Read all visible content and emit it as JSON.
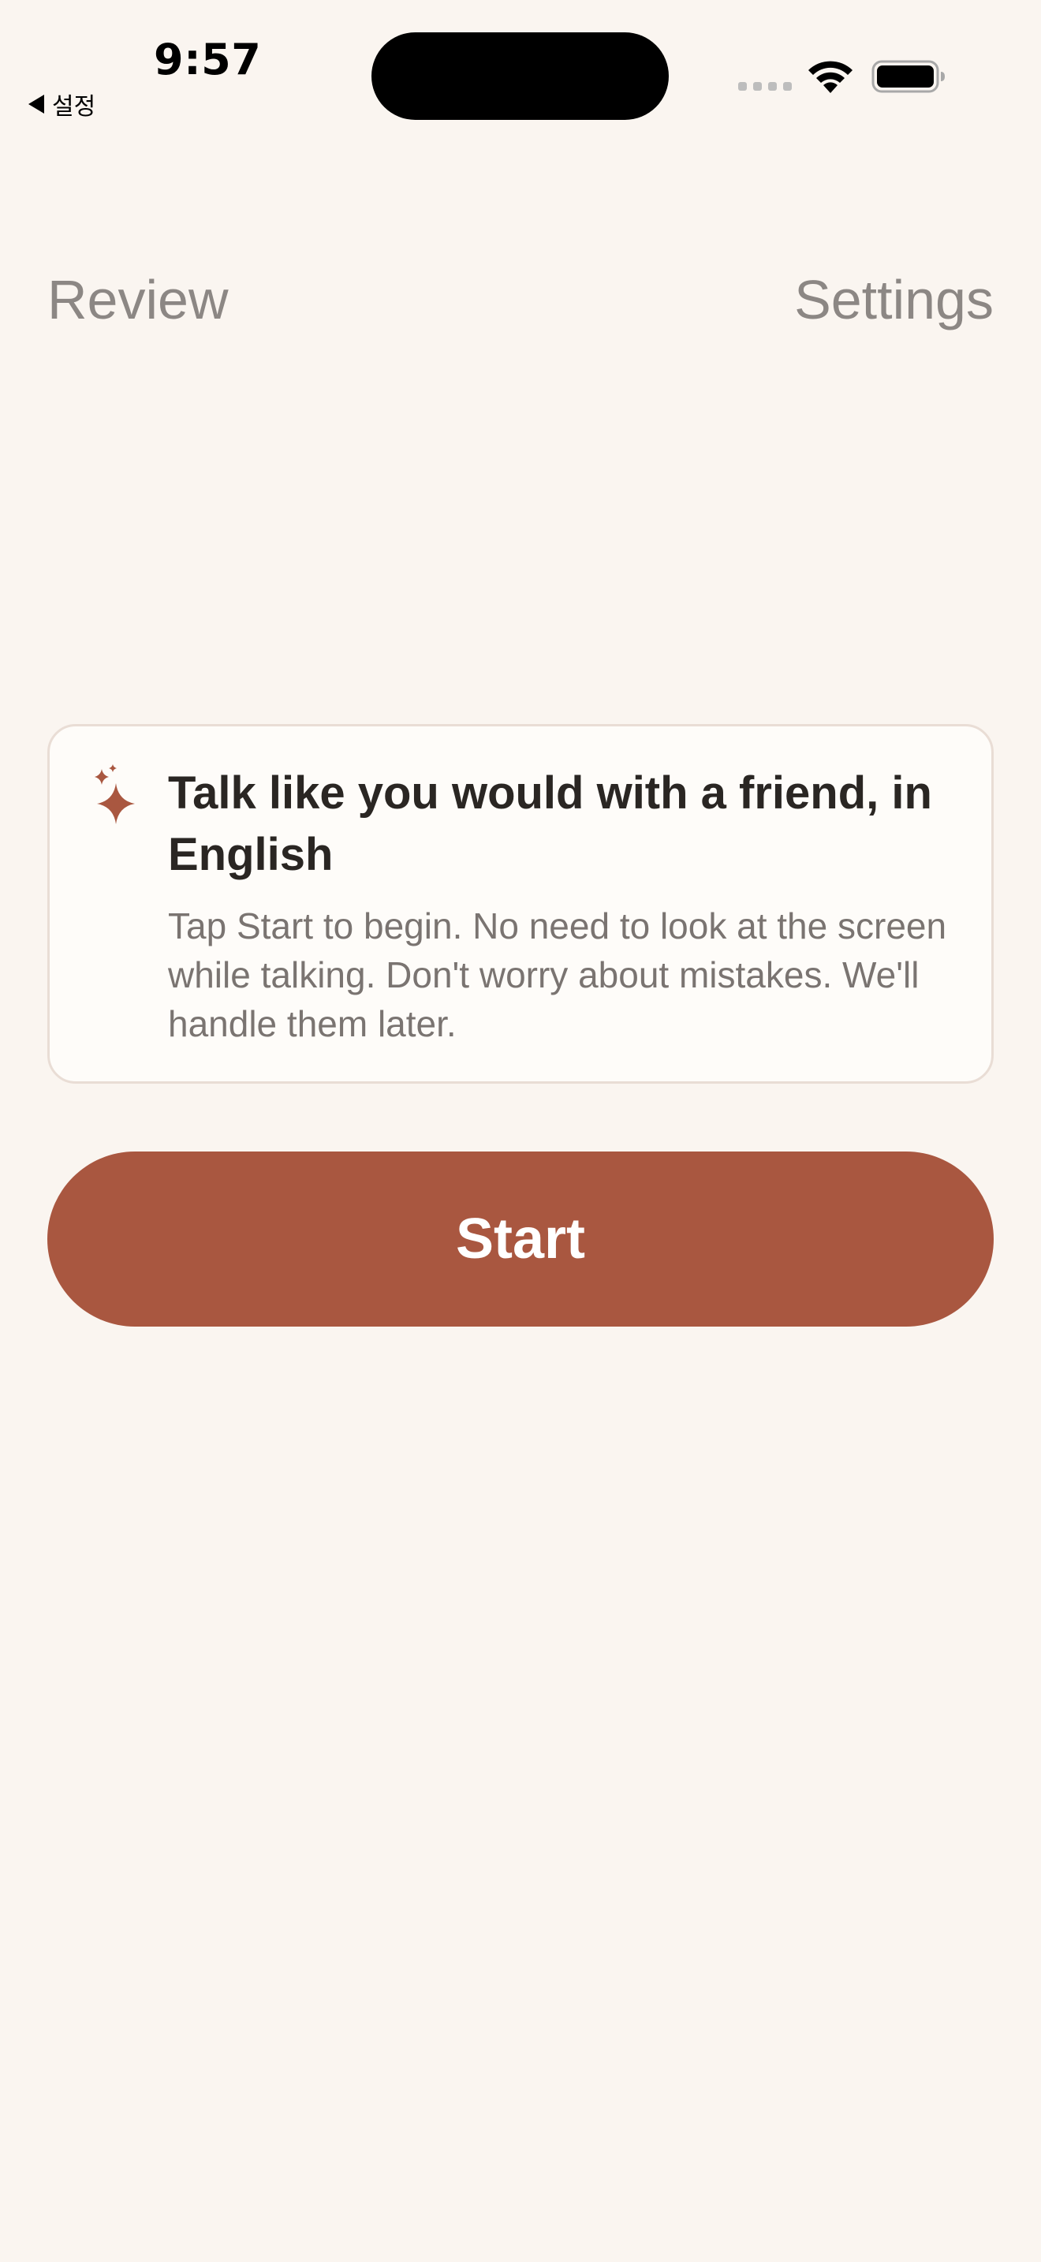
{
  "status_bar": {
    "time": "9:57",
    "back_label": "설정",
    "icons": [
      "signal-dots-icon",
      "wifi-icon",
      "battery-icon"
    ]
  },
  "nav": {
    "review_label": "Review",
    "settings_label": "Settings"
  },
  "card": {
    "icon": "sparkle-icon",
    "title": "Talk like you would with a friend, in English",
    "body": "Tap Start to begin. No need to look at the screen while talking. Don't worry about mistakes. We'll handle them later."
  },
  "start_button": {
    "label": "Start"
  },
  "colors": {
    "background": "#FAF5F0",
    "accent": "#A95740",
    "nav_text": "#8C8784",
    "card_background": "#FEFCF9",
    "card_border": "#E9DDD5",
    "title_text": "#2A2623",
    "body_text": "#7A7471"
  }
}
